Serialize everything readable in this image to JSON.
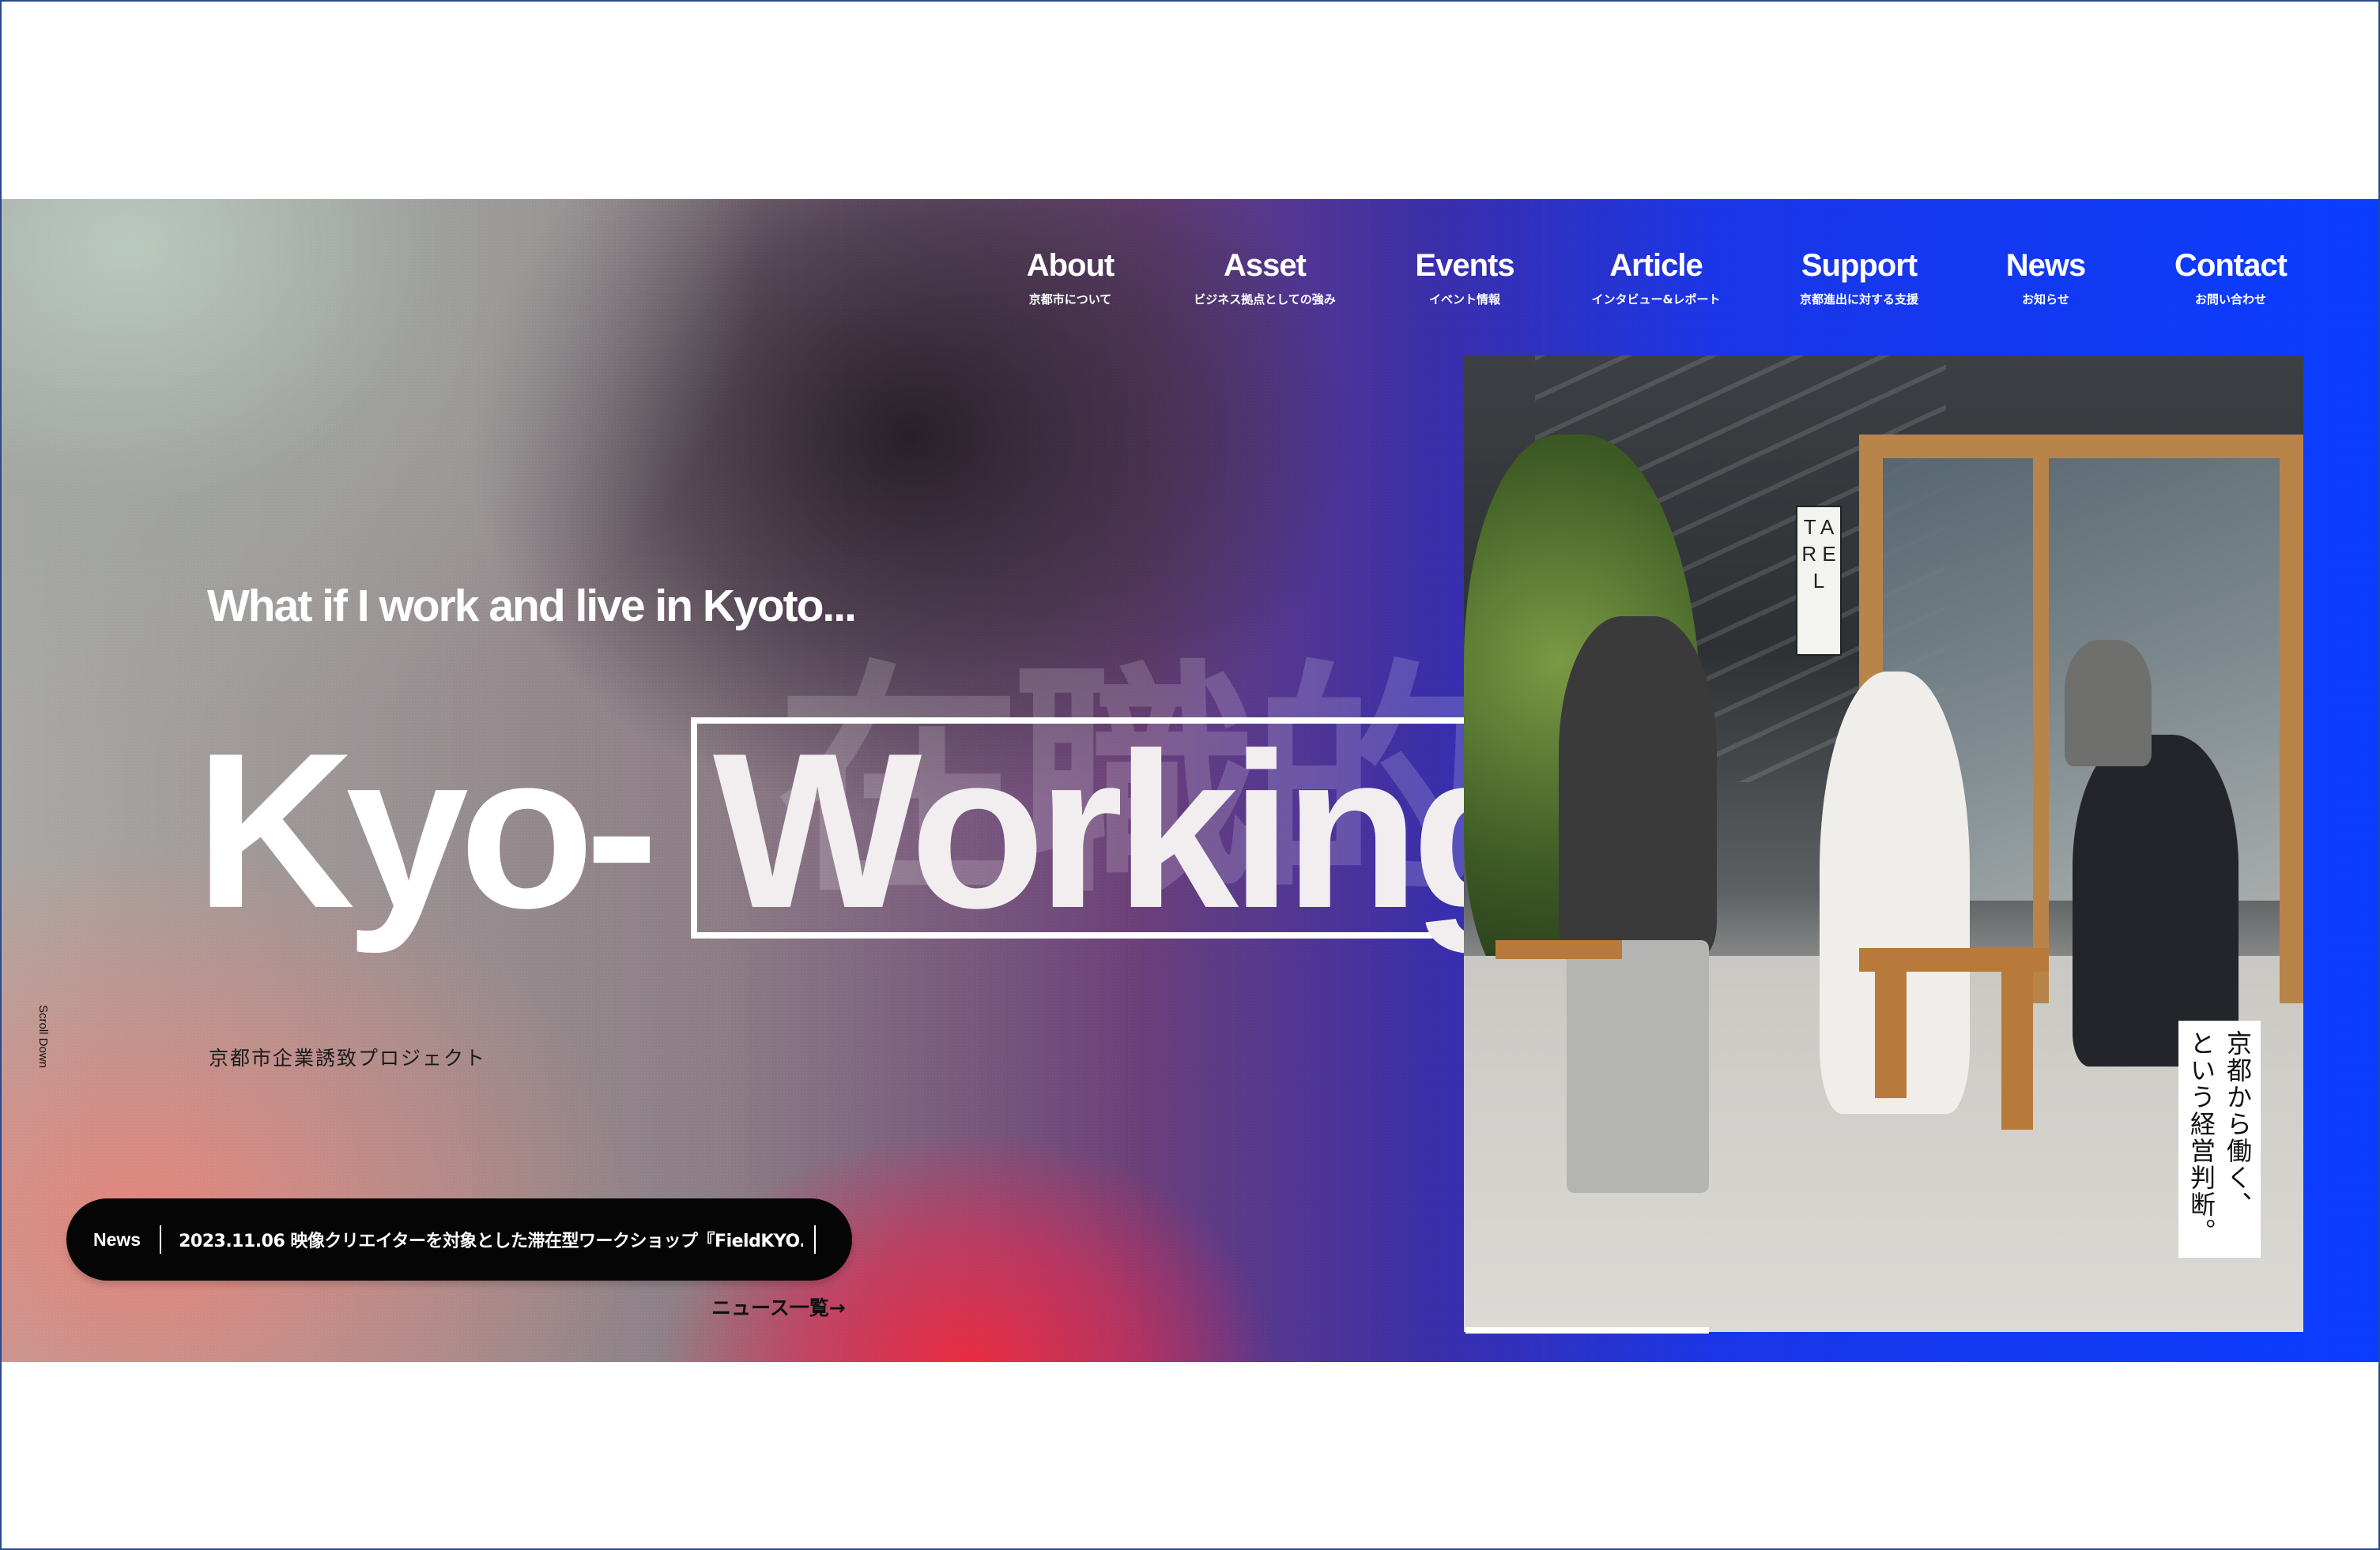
{
  "nav": {
    "items": [
      {
        "label": "About",
        "sub": "京都市について"
      },
      {
        "label": "Asset",
        "sub": "ビジネス拠点としての強み"
      },
      {
        "label": "Events",
        "sub": "イベント情報"
      },
      {
        "label": "Article",
        "sub": "インタビュー&レポート"
      },
      {
        "label": "Support",
        "sub": "京都進出に対する支援"
      },
      {
        "label": "News",
        "sub": "お知らせ"
      },
      {
        "label": "Contact",
        "sub": "お問い合わせ"
      }
    ]
  },
  "hero": {
    "tagline": "What if I work and live in Kyoto...",
    "title_prefix": "Kyo-",
    "title_word": "Working",
    "watermark": "在職的",
    "project": "京都市企業誘致プロジェクト",
    "scroll_hint": "Scroll Down"
  },
  "news": {
    "tag": "News",
    "headline": "2023.11.06 映像クリエイターを対象とした滞在型ワークショップ『FieldKYO…",
    "list_link": "ニュース一覧→"
  },
  "photo": {
    "sign": "T A R E L",
    "caption_lines": [
      "京都から働く、",
      "という経営判断。"
    ],
    "slide_progress": 0.29
  },
  "colors": {
    "accent_blue": "#0a3cff",
    "accent_red": "#f0283c"
  }
}
